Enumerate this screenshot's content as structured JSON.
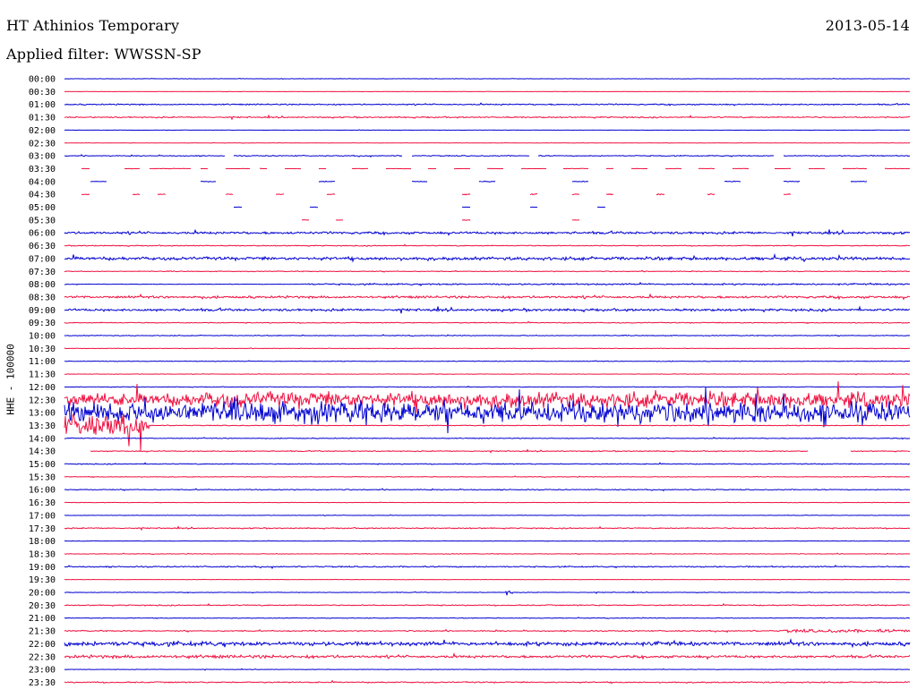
{
  "header": {
    "station": "HT Athinios Temporary",
    "date": "2013-05-14",
    "filter": "Applied filter: WWSSN-SP"
  },
  "chart_data": {
    "type": "line",
    "ylabel": "HHE - 100000",
    "colors": [
      "#0000d0",
      "#f01040"
    ],
    "times": [
      "00:00",
      "00:30",
      "01:00",
      "01:30",
      "02:00",
      "02:30",
      "03:00",
      "03:30",
      "04:00",
      "04:30",
      "05:00",
      "05:30",
      "06:00",
      "06:30",
      "07:00",
      "07:30",
      "08:00",
      "08:30",
      "09:00",
      "09:30",
      "10:00",
      "10:30",
      "11:00",
      "11:30",
      "12:00",
      "12:30",
      "13:00",
      "13:30",
      "14:00",
      "14:30",
      "15:00",
      "15:30",
      "16:00",
      "16:30",
      "17:00",
      "17:30",
      "18:00",
      "18:30",
      "19:00",
      "19:30",
      "20:00",
      "20:30",
      "21:00",
      "21:30",
      "22:00",
      "22:30",
      "23:00",
      "23:30"
    ],
    "noise_level": [
      0.3,
      0.2,
      0.8,
      0.8,
      0.2,
      0.2,
      0.6,
      0.3,
      0.5,
      0.7,
      0.3,
      0.5,
      0.8,
      0.6,
      0.6,
      0.5,
      0.3,
      1.5,
      1.5,
      0.6,
      0.5,
      0.3,
      0.4,
      0.3,
      0.4,
      8,
      14,
      0.5,
      0.5,
      0.6,
      0.6,
      0.4,
      0.6,
      0.3,
      0.3,
      0.7,
      0.3,
      0.4,
      0.8,
      0.2,
      0.4,
      0.7,
      0.4,
      0.7,
      2.5,
      1.6,
      0.3,
      0.8
    ],
    "gaps": {
      "6": [
        [
          0.19,
          0.2
        ],
        [
          0.4,
          0.41
        ],
        [
          0.55,
          0.56
        ],
        [
          0.84,
          0.85
        ]
      ],
      "7": [
        [
          0.0,
          0.02
        ],
        [
          0.03,
          0.07
        ],
        [
          0.09,
          0.1
        ],
        [
          0.15,
          0.16
        ],
        [
          0.17,
          0.19
        ],
        [
          0.22,
          0.23
        ],
        [
          0.24,
          0.26
        ],
        [
          0.28,
          0.3
        ],
        [
          0.31,
          0.34
        ],
        [
          0.36,
          0.38
        ],
        [
          0.41,
          0.43
        ],
        [
          0.44,
          0.46
        ],
        [
          0.48,
          0.5
        ],
        [
          0.52,
          0.54
        ],
        [
          0.57,
          0.59
        ],
        [
          0.62,
          0.64
        ],
        [
          0.65,
          0.67
        ],
        [
          0.69,
          0.71
        ],
        [
          0.73,
          0.75
        ],
        [
          0.77,
          0.79
        ],
        [
          0.81,
          0.84
        ],
        [
          0.86,
          0.88
        ],
        [
          0.9,
          0.92
        ],
        [
          0.95,
          0.97
        ]
      ],
      "8": [
        [
          0.0,
          0.03
        ],
        [
          0.05,
          0.16
        ],
        [
          0.18,
          0.3
        ],
        [
          0.32,
          0.41
        ],
        [
          0.43,
          0.49
        ],
        [
          0.51,
          0.6
        ],
        [
          0.62,
          0.78
        ],
        [
          0.8,
          0.85
        ],
        [
          0.87,
          0.93
        ],
        [
          0.95,
          1.0
        ]
      ],
      "9": [
        [
          0.0,
          0.02
        ],
        [
          0.03,
          0.08
        ],
        [
          0.09,
          0.11
        ],
        [
          0.12,
          0.19
        ],
        [
          0.2,
          0.25
        ],
        [
          0.26,
          0.31
        ],
        [
          0.32,
          0.47
        ],
        [
          0.48,
          0.55
        ],
        [
          0.56,
          0.6
        ],
        [
          0.61,
          0.64
        ],
        [
          0.65,
          0.7
        ],
        [
          0.71,
          0.76
        ],
        [
          0.77,
          0.85
        ],
        [
          0.86,
          1.0
        ]
      ],
      "10": [
        [
          0.0,
          0.2
        ],
        [
          0.21,
          0.29
        ],
        [
          0.3,
          0.47
        ],
        [
          0.48,
          0.55
        ],
        [
          0.56,
          0.63
        ],
        [
          0.64,
          1.0
        ]
      ],
      "11": [
        [
          0.0,
          0.28
        ],
        [
          0.29,
          0.32
        ],
        [
          0.33,
          0.47
        ],
        [
          0.48,
          0.6
        ],
        [
          0.61,
          1.0
        ]
      ],
      "27": [
        [
          0.0,
          0.0
        ]
      ],
      "29": [
        [
          0.0,
          0.03
        ],
        [
          0.88,
          0.93
        ]
      ]
    },
    "events": [
      {
        "row": 12,
        "start": 0.0,
        "end": 1.0,
        "amp": 1.5
      },
      {
        "row": 14,
        "start": 0.0,
        "end": 1.0,
        "amp": 2.0
      },
      {
        "row": 16,
        "start": 0.28,
        "end": 0.48,
        "amp": 1.0
      },
      {
        "row": 16,
        "start": 0.49,
        "end": 1.0,
        "amp": 1.0
      },
      {
        "row": 25,
        "start": 0.16,
        "end": 1.0,
        "amp": 10
      },
      {
        "row": 26,
        "start": 0.0,
        "end": 0.1,
        "amp": 14
      },
      {
        "row": 26,
        "start": 0.1,
        "end": 0.18,
        "amp": 4
      },
      {
        "row": 27,
        "start": 0.0,
        "end": 0.1,
        "amp": 14
      },
      {
        "row": 40,
        "start": 0.52,
        "end": 0.53,
        "amp": 3
      },
      {
        "row": 43,
        "start": 0.85,
        "end": 1.0,
        "amp": 2
      },
      {
        "row": 44,
        "start": 0.0,
        "end": 0.18,
        "amp": 3
      },
      {
        "row": 45,
        "start": 0.0,
        "end": 0.33,
        "amp": 2
      }
    ]
  }
}
